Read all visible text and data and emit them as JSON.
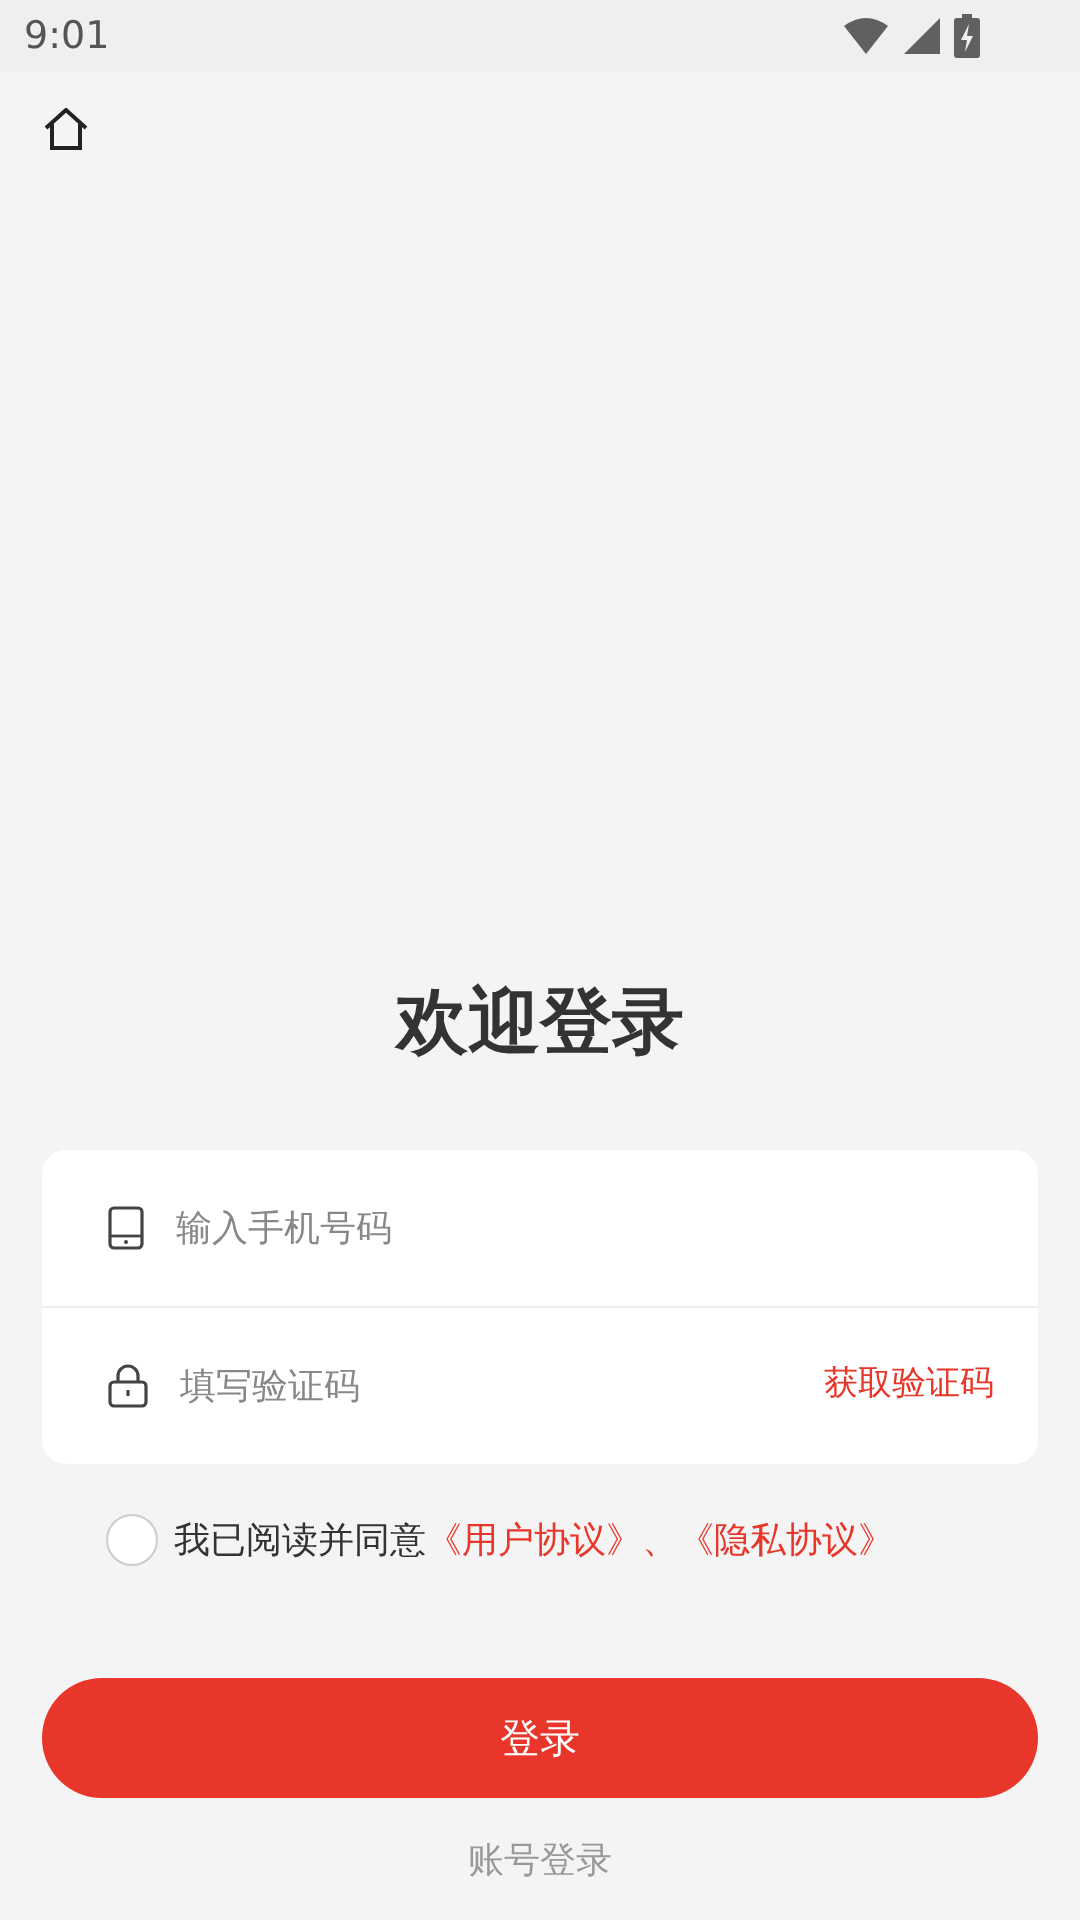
{
  "status_bar": {
    "time": "9:01"
  },
  "title": "欢迎登录",
  "phone_field": {
    "placeholder": "输入手机号码"
  },
  "code_field": {
    "placeholder": "填写验证码"
  },
  "get_code_link": "获取验证码",
  "agreement": {
    "checked": false,
    "parts": [
      {
        "kind": "text",
        "text": "我已阅读并同意"
      },
      {
        "kind": "link",
        "text": "《用户协议》"
      },
      {
        "kind": "separator",
        "text": "、"
      },
      {
        "kind": "link",
        "text": "《隐私协议》"
      }
    ]
  },
  "login_button": "登录",
  "account_login_link": "账号登录"
}
